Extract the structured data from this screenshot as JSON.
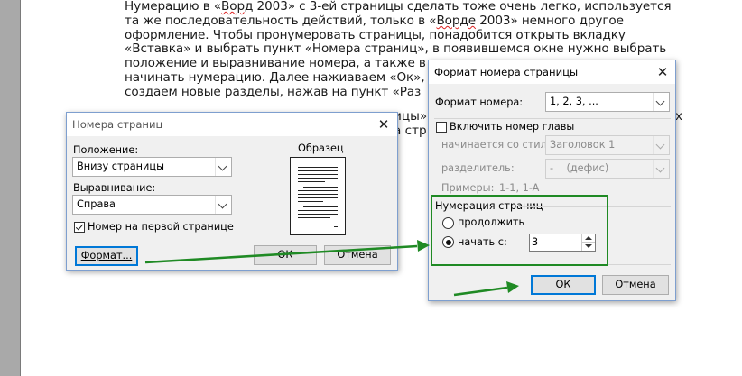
{
  "document": {
    "lines": [
      "Нумерацию в «Ворд 2003» с 3-ей страницы сделать тоже очень легко, используется",
      "та же последовательность действий, только в «Ворде 2003» немного другое",
      "оформление. Чтобы пронумеровать страницы, понадобится открыть вкладку",
      "«Вставка» и выбрать пункт «Номера страниц», в появившемся окне нужно выбрать",
      "положение и выравнивание номера, а также в",
      "начинать нумерацию. Далее нажиаваем «Ок»,",
      "создаем новые разделы, нажав на пункт «Раз",
      "",
      ""
    ],
    "fragment_line8": "ицы»,",
    "fragment_line9": "а стр",
    "fragment_right": "х"
  },
  "page_numbers_dialog": {
    "title": "Номера страниц",
    "close": "✕",
    "position_label": "Положение:",
    "position_value": "Внизу страницы",
    "alignment_label": "Выравнивание:",
    "alignment_value": "Справа",
    "first_page_label": "Номер на первой странице",
    "first_page_checked": true,
    "sample_label": "Образец",
    "format_button": "Формат...",
    "ok_button": "ОК",
    "cancel_button": "Отмена"
  },
  "format_dialog": {
    "title": "Формат номера страницы",
    "close": "✕",
    "number_format_label": "Формат номера:",
    "number_format_value": "1, 2, 3, ...",
    "include_chapter_label": "Включить номер главы",
    "include_chapter_checked": false,
    "starts_with_style_label": "начинается со стиля",
    "starts_with_style_value": "Заголовок 1",
    "separator_label": "разделитель:",
    "separator_value": "-    (дефис)",
    "examples_label": "Примеры:",
    "examples_value": "1-1, 1-A",
    "numbering_group_label": "Нумерация страниц",
    "continue_label": "продолжить",
    "start_at_label": "начать с:",
    "start_at_value": "3",
    "selected_option": "start_at",
    "ok_button": "ОК",
    "cancel_button": "Отмена"
  },
  "colors": {
    "highlight_green": "#1f8a24",
    "dialog_border": "#7e9fcf",
    "default_button_border": "#0078d7"
  }
}
